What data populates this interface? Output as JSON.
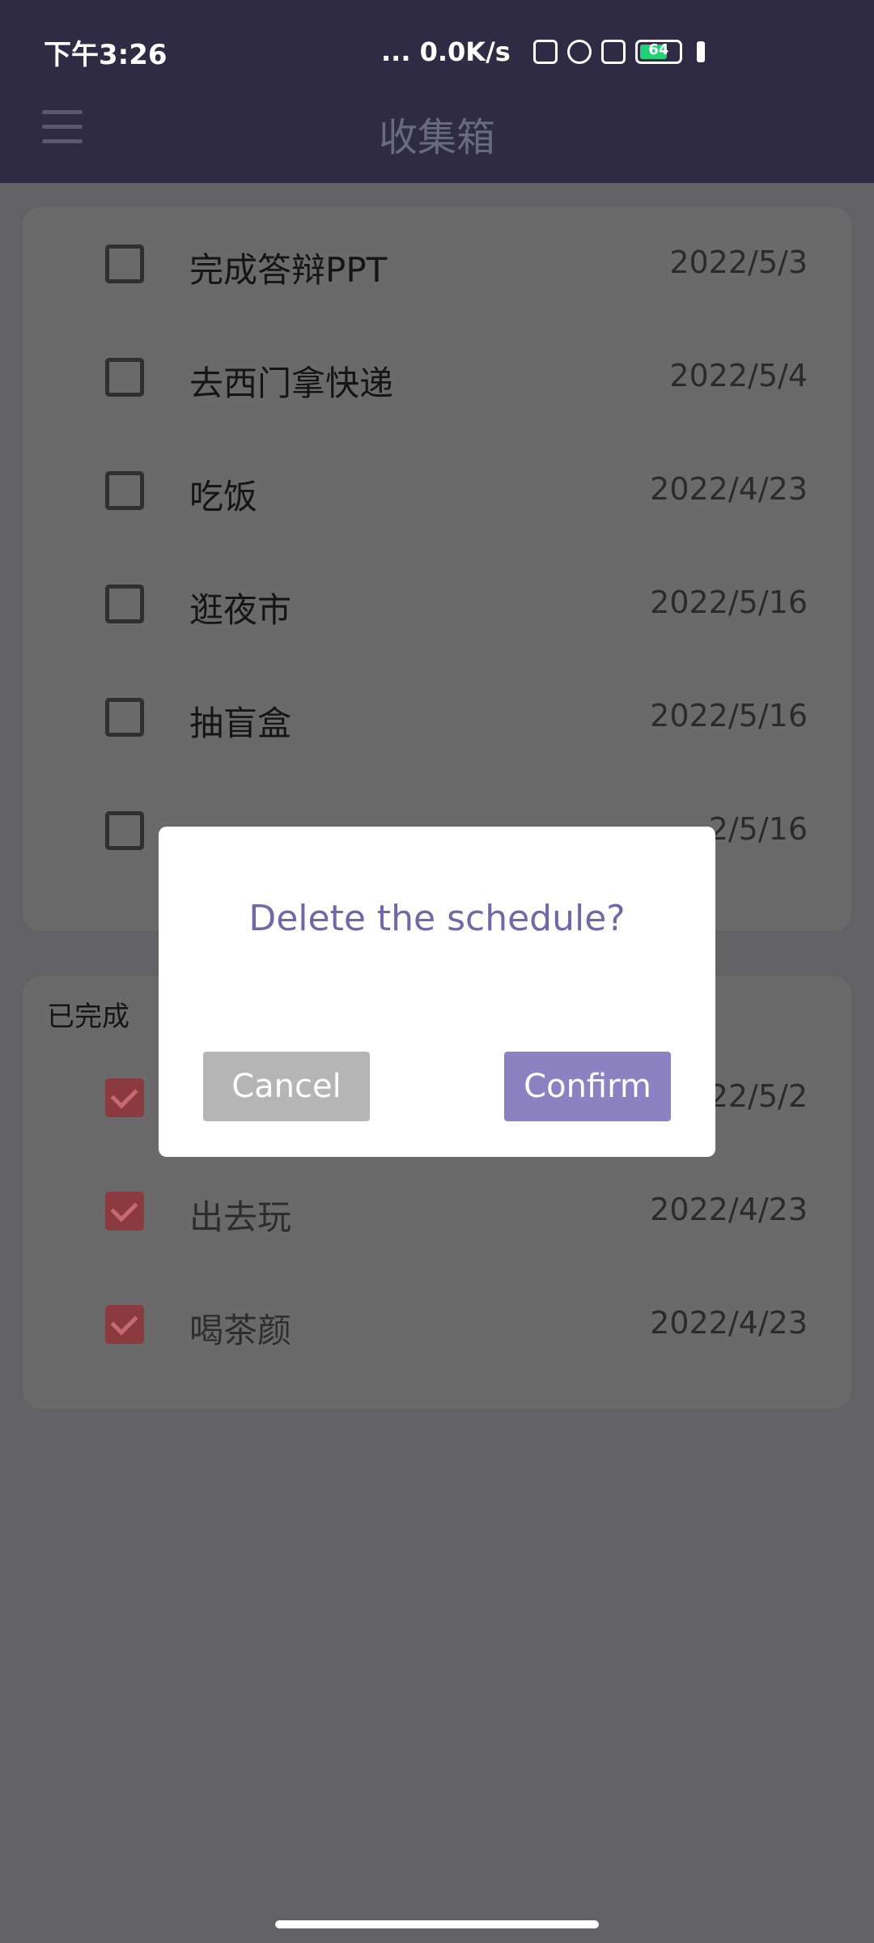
{
  "status_bar": {
    "time": "下午3:26",
    "network_speed": "... 0.0K/s",
    "battery_level": "64",
    "battery_fraction": 0.64,
    "icons": [
      "no-sim-icon",
      "hotspot-icon",
      "wifi-icon",
      "battery-icon",
      "charging-plug-icon"
    ]
  },
  "app_bar": {
    "title": "收集箱",
    "menu_icon": "hamburger-menu-icon"
  },
  "todo_section": {
    "items": [
      {
        "title": "完成答辩PPT",
        "date": "2022/5/3",
        "checked": false
      },
      {
        "title": "去西门拿快递",
        "date": "2022/5/4",
        "checked": false
      },
      {
        "title": "吃饭",
        "date": "2022/4/23",
        "checked": false
      },
      {
        "title": "逛夜市",
        "date": "2022/5/16",
        "checked": false
      },
      {
        "title": "抽盲盒",
        "date": "2022/5/16",
        "checked": false
      },
      {
        "title": "",
        "date": "2/5/16",
        "checked": false
      }
    ]
  },
  "done_section": {
    "label": "已完成",
    "items": [
      {
        "title": "",
        "date": "22/5/2",
        "checked": true
      },
      {
        "title": "出去玩",
        "date": "2022/4/23",
        "checked": true
      },
      {
        "title": "喝茶颜",
        "date": "2022/4/23",
        "checked": true
      }
    ]
  },
  "dialog": {
    "title": "Delete the schedule?",
    "cancel_label": "Cancel",
    "confirm_label": "Confirm"
  },
  "colors": {
    "header": "#2f2b45",
    "accent": "#8d82c1",
    "dialog_title": "#7068a8",
    "checked": "#8b3b40"
  }
}
